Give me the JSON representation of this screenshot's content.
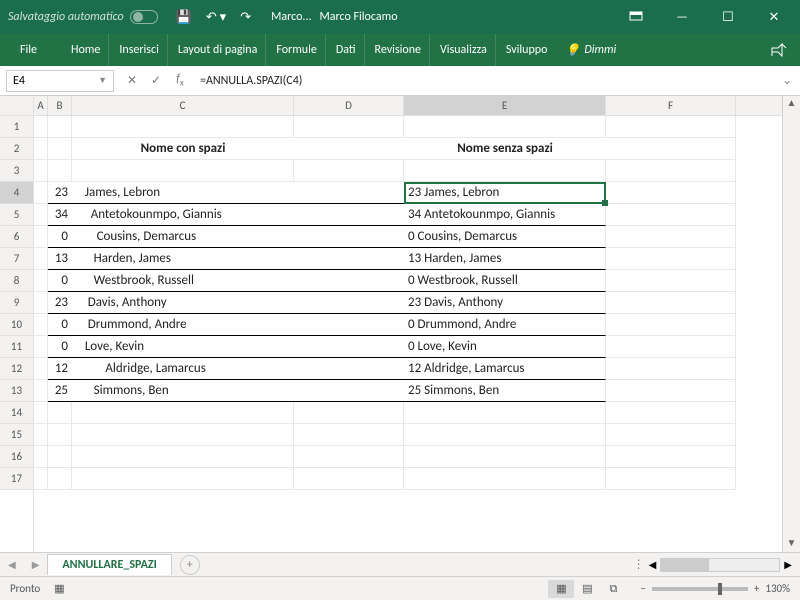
{
  "titlebar": {
    "autosave_label": "Salvataggio automatico",
    "doc_name": "Marco...",
    "user_name": "Marco Filocamo"
  },
  "ribbon": {
    "tabs": [
      "File",
      "Home",
      "Inserisci",
      "Layout di pagina",
      "Formule",
      "Dati",
      "Revisione",
      "Visualizza",
      "Sviluppo"
    ],
    "tell_me": "Dimmi"
  },
  "formula_bar": {
    "cell_ref": "E4",
    "formula": "=ANNULLA.SPAZI(C4)"
  },
  "columns": [
    "A",
    "B",
    "C",
    "D",
    "E",
    "F"
  ],
  "header_row": {
    "c": "Nome con spazi",
    "e": "Nome senza spazi"
  },
  "data_rows": [
    {
      "b": "23",
      "c": "   James, Lebron",
      "e": "23 James, Lebron"
    },
    {
      "b": "34",
      "c": "     Antetokounmpo, Giannis",
      "e": "34 Antetokounmpo, Giannis"
    },
    {
      "b": "0",
      "c": "       Cousins, Demarcus",
      "e": "0 Cousins, Demarcus"
    },
    {
      "b": "13",
      "c": "      Harden, James",
      "e": "13 Harden, James"
    },
    {
      "b": "0",
      "c": "      Westbrook, Russell",
      "e": "0 Westbrook, Russell"
    },
    {
      "b": "23",
      "c": "    Davis, Anthony",
      "e": "23 Davis, Anthony"
    },
    {
      "b": "0",
      "c": "    Drummond, Andre",
      "e": "0 Drummond, Andre"
    },
    {
      "b": "0",
      "c": "   Love, Kevin",
      "e": "0 Love, Kevin"
    },
    {
      "b": "12",
      "c": "          Aldridge, Lamarcus",
      "e": "12 Aldridge, Lamarcus"
    },
    {
      "b": "25",
      "c": "      Simmons, Ben",
      "e": "25 Simmons, Ben"
    }
  ],
  "sheet_tab": "ANNULLARE_SPAZI",
  "status": {
    "ready": "Pronto",
    "zoom": "130%"
  },
  "chart_data": {
    "type": "table",
    "title": "ANNULLA.SPAZI demo",
    "columns": [
      "#",
      "Nome con spazi",
      "Nome senza spazi"
    ],
    "rows": [
      [
        23,
        "   James, Lebron",
        "23 James, Lebron"
      ],
      [
        34,
        "     Antetokounmpo, Giannis",
        "34 Antetokounmpo, Giannis"
      ],
      [
        0,
        "       Cousins, Demarcus",
        "0 Cousins, Demarcus"
      ],
      [
        13,
        "      Harden, James",
        "13 Harden, James"
      ],
      [
        0,
        "      Westbrook, Russell",
        "0 Westbrook, Russell"
      ],
      [
        23,
        "    Davis, Anthony",
        "23 Davis, Anthony"
      ],
      [
        0,
        "    Drummond, Andre",
        "0 Drummond, Andre"
      ],
      [
        0,
        "   Love, Kevin",
        "0 Love, Kevin"
      ],
      [
        12,
        "          Aldridge, Lamarcus",
        "12 Aldridge, Lamarcus"
      ],
      [
        25,
        "      Simmons, Ben",
        "25 Simmons, Ben"
      ]
    ]
  }
}
